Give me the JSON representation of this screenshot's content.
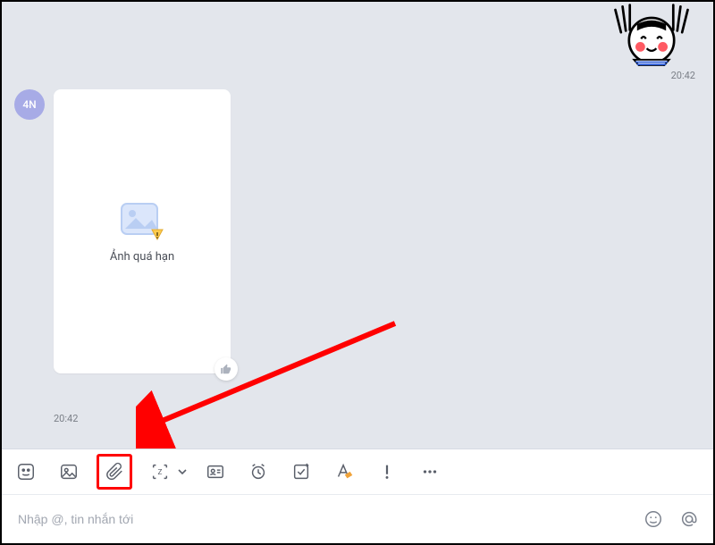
{
  "chat": {
    "outgoing_time": "20:42",
    "incoming_time": "20:42",
    "avatar_initials": "4N",
    "image_expired_text": "Ảnh quá hạn"
  },
  "toolbar": {
    "icons": {
      "sticker": "sticker-icon",
      "image": "image-icon",
      "attach": "attach-icon",
      "screenshot": "screenshot-icon",
      "contact": "contact-card-icon",
      "reminder": "reminder-icon",
      "task": "task-icon",
      "format": "format-icon",
      "priority": "priority-icon",
      "more": "more-icon"
    }
  },
  "input": {
    "placeholder": "Nhập @, tin nhắn tới",
    "emoji_icon": "emoji-icon",
    "mention_icon": "mention-icon"
  },
  "annotation": {
    "color": "#ff0000"
  }
}
